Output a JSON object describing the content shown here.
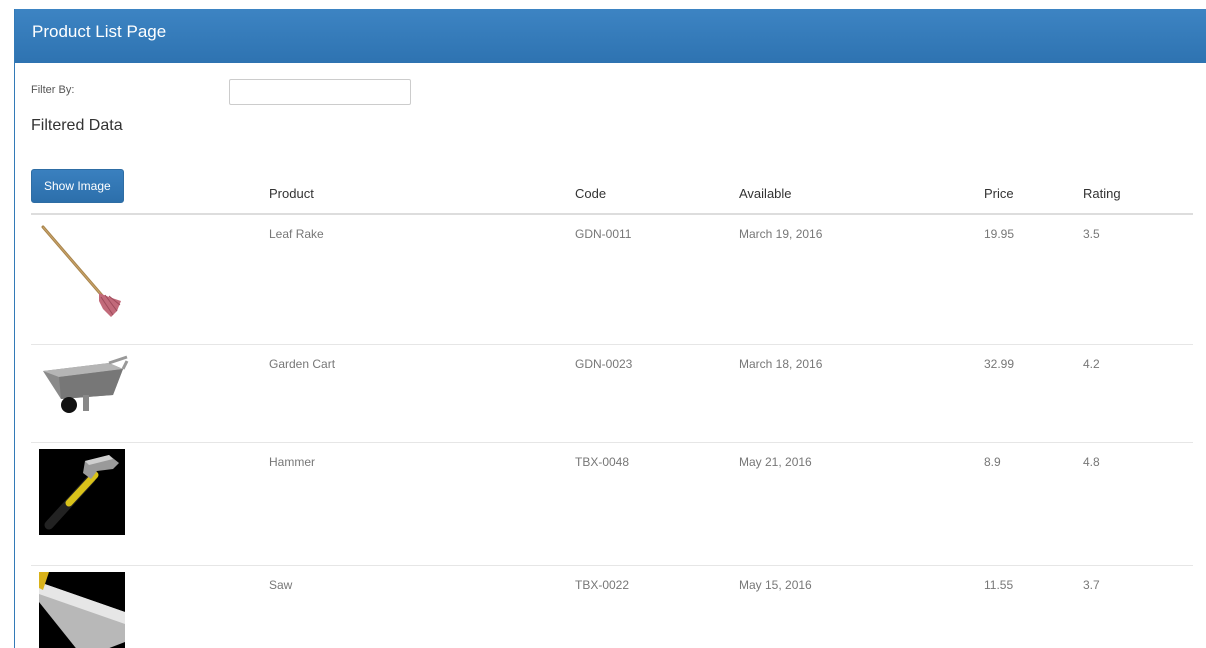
{
  "header": {
    "title": "Product List Page"
  },
  "filter": {
    "label": "Filter By:",
    "value": "",
    "placeholder": ""
  },
  "filtered_title": "Filtered Data",
  "table": {
    "show_image_label": "Show Image",
    "columns": [
      "Product",
      "Code",
      "Available",
      "Price",
      "Rating"
    ],
    "rows": [
      {
        "product": "Leaf Rake",
        "code": "GDN-0011",
        "available": "March 19, 2016",
        "price": "19.95",
        "rating": "3.5",
        "icon": "leaf-rake-icon"
      },
      {
        "product": "Garden Cart",
        "code": "GDN-0023",
        "available": "March 18, 2016",
        "price": "32.99",
        "rating": "4.2",
        "icon": "garden-cart-icon"
      },
      {
        "product": "Hammer",
        "code": "TBX-0048",
        "available": "May 21, 2016",
        "price": "8.9",
        "rating": "4.8",
        "icon": "hammer-icon"
      },
      {
        "product": "Saw",
        "code": "TBX-0022",
        "available": "May 15, 2016",
        "price": "11.55",
        "rating": "3.7",
        "icon": "saw-icon"
      }
    ]
  },
  "colors": {
    "primary": "#337ab7",
    "text": "#333333",
    "muted": "#777777"
  }
}
